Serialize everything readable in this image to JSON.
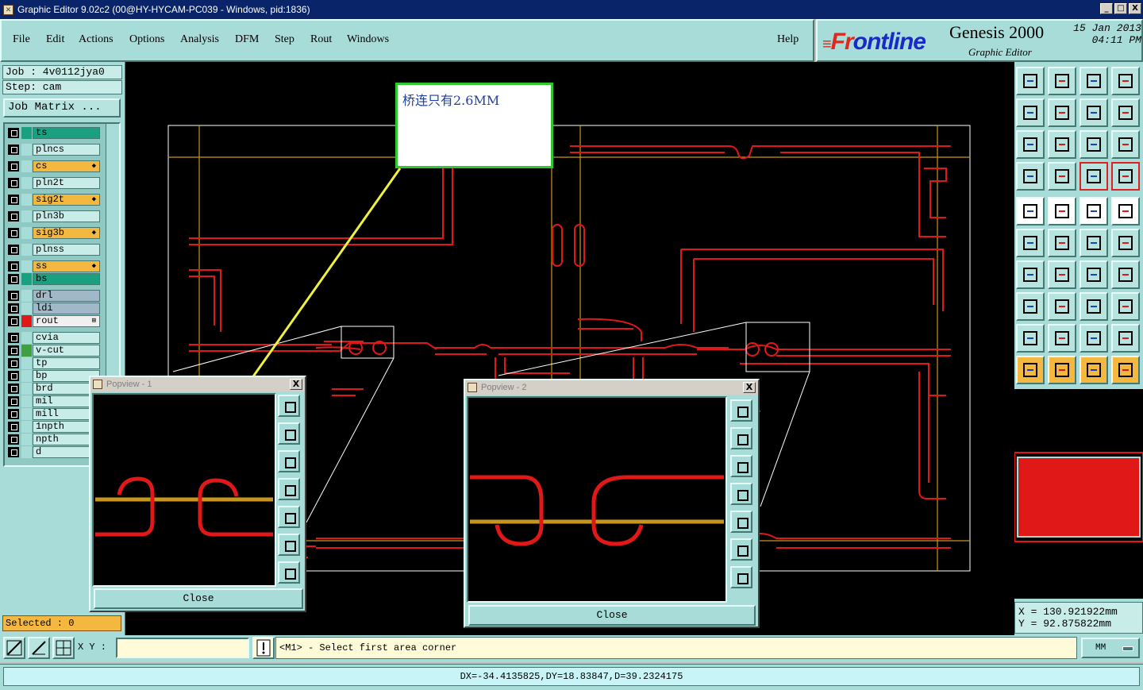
{
  "window": {
    "title": "Graphic Editor 9.02c2 (00@HY-HYCAM-PC039 - Windows, pid:1836)",
    "btn_min": "_",
    "btn_max": "□",
    "btn_close": "X"
  },
  "menu": {
    "file": "File",
    "edit": "Edit",
    "actions": "Actions",
    "options": "Options",
    "analysis": "Analysis",
    "dfm": "DFM",
    "step": "Step",
    "rout": "Rout",
    "windows": "Windows",
    "help": "Help"
  },
  "logo": {
    "brand_f": "Fr",
    "brand_rest": "ontline",
    "product": "Genesis 2000",
    "subtitle": "Graphic Editor",
    "date": "15 Jan 2013",
    "time": "04:11 PM"
  },
  "job": {
    "job_label": "Job : 4v0112jya0",
    "step_label": "Step: cam",
    "matrix": "Job Matrix ..."
  },
  "layers": [
    {
      "name": "ts",
      "color": "#1aa080",
      "bg": "#1aa080",
      "arrow": ""
    },
    {
      "name": "plncs",
      "color": "#a8dcd8",
      "bg": "#c8ece8",
      "arrow": ""
    },
    {
      "name": "cs",
      "color": "#a8dcd8",
      "bg": "#f4b840",
      "arrow": "◆"
    },
    {
      "name": "pln2t",
      "color": "#a8dcd8",
      "bg": "#c8ece8",
      "arrow": ""
    },
    {
      "name": "sig2t",
      "color": "#a8dcd8",
      "bg": "#f4b840",
      "arrow": "◆"
    },
    {
      "name": "pln3b",
      "color": "#a8dcd8",
      "bg": "#c8ece8",
      "arrow": ""
    },
    {
      "name": "sig3b",
      "color": "#a8dcd8",
      "bg": "#f4b840",
      "arrow": "◆"
    },
    {
      "name": "plnss",
      "color": "#a8dcd8",
      "bg": "#c8ece8",
      "arrow": ""
    },
    {
      "name": "ss",
      "color": "#a8dcd8",
      "bg": "#f4b840",
      "arrow": "◆"
    },
    {
      "name": "bs",
      "color": "#1aa080",
      "bg": "#1aa080",
      "arrow": ""
    },
    {
      "name": "drl",
      "color": "#a8dcd8",
      "bg": "#a0b8c8",
      "arrow": ""
    },
    {
      "name": "ldi",
      "color": "#a8dcd8",
      "bg": "#a0b8c8",
      "arrow": ""
    },
    {
      "name": "rout",
      "color": "#e01818",
      "bg": "#f0f0f0",
      "arrow": "⊞"
    },
    {
      "name": "cvia",
      "color": "#a8dcd8",
      "bg": "#c8ece8",
      "arrow": ""
    },
    {
      "name": "v-cut",
      "color": "#40a040",
      "bg": "#c8ece8",
      "arrow": ""
    },
    {
      "name": "tp",
      "color": "#a8dcd8",
      "bg": "#c8ece8",
      "arrow": ""
    },
    {
      "name": "bp",
      "color": "#a8dcd8",
      "bg": "#c8ece8",
      "arrow": ""
    },
    {
      "name": "brd",
      "color": "#a8dcd8",
      "bg": "#c8ece8",
      "arrow": ""
    },
    {
      "name": "mil",
      "color": "#a8dcd8",
      "bg": "#c8ece8",
      "arrow": ""
    },
    {
      "name": "mill",
      "color": "#a8dcd8",
      "bg": "#c8ece8",
      "arrow": ""
    },
    {
      "name": "1npth",
      "color": "#a8dcd8",
      "bg": "#c8ece8",
      "arrow": ""
    },
    {
      "name": "npth",
      "color": "#a8dcd8",
      "bg": "#c8ece8",
      "arrow": ""
    },
    {
      "name": "d",
      "color": "#a8dcd8",
      "bg": "#c8ece8",
      "arrow": ""
    }
  ],
  "selected": "Selected : 0",
  "annotation": "桥连只有2.6MM",
  "popview1": {
    "title": "Popview - 1",
    "close": "Close",
    "close_x": "X"
  },
  "popview2": {
    "title": "Popview - 2",
    "close": "Close",
    "close_x": "X"
  },
  "coords": {
    "x": "X = 130.921922mm",
    "y": "Y = 92.875822mm"
  },
  "xy_label": "X Y :",
  "xy_value": "",
  "prompt": "<M1> - Select first area corner",
  "units": "MM",
  "measure": "DX=-34.4135825,DY=18.83847,D=39.2324175",
  "colors": {
    "rout": "#e01818",
    "vcut": "#c8961e",
    "outline": "#ffffff",
    "accent": "#a8dcd8"
  }
}
